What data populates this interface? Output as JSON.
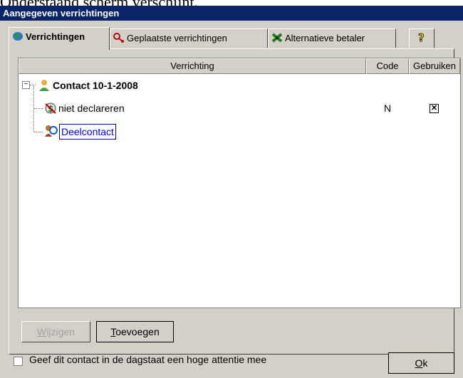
{
  "background_text": "Onderstaand scherm verschijnt.",
  "window": {
    "title": "Aangegeven verrichtingen"
  },
  "tabs": [
    {
      "label": "Verrichtingen",
      "icon": "globe-icon",
      "active": true
    },
    {
      "label": "Geplaatste verrichtingen",
      "icon": "stethoscope-icon",
      "active": false
    },
    {
      "label": "Alternatieve betaler",
      "icon": "money-icon",
      "active": false
    },
    {
      "label": "",
      "icon": "help-icon",
      "active": false
    }
  ],
  "grid": {
    "columns": [
      "Verrichting",
      "Code",
      "Gebruiken"
    ],
    "rows": [
      {
        "label": "Contact 10-1-2008",
        "code": "",
        "checked": null,
        "icon": "person-icon",
        "level": 0
      },
      {
        "label": "niet declareren",
        "code": "N",
        "checked": true,
        "icon": "dollar-icon",
        "level": 1
      },
      {
        "label": "Deelcontact",
        "code": "",
        "checked": null,
        "icon": "people-icon",
        "level": 1
      }
    ]
  },
  "buttons": {
    "edit": {
      "pre": "",
      "mnemonic": "W",
      "post": "ijzigen"
    },
    "add": {
      "pre": "",
      "mnemonic": "T",
      "post": "oevoegen"
    },
    "ok": {
      "pre": "",
      "mnemonic": "O",
      "post": "k"
    }
  },
  "attention_checkbox": {
    "label": "Geef dit contact in de dagstaat een hoge attentie mee",
    "checked": false
  },
  "colors": {
    "titlebar": "#0a246a",
    "face": "#d4d0c8",
    "selection_text": "#0000ff"
  }
}
